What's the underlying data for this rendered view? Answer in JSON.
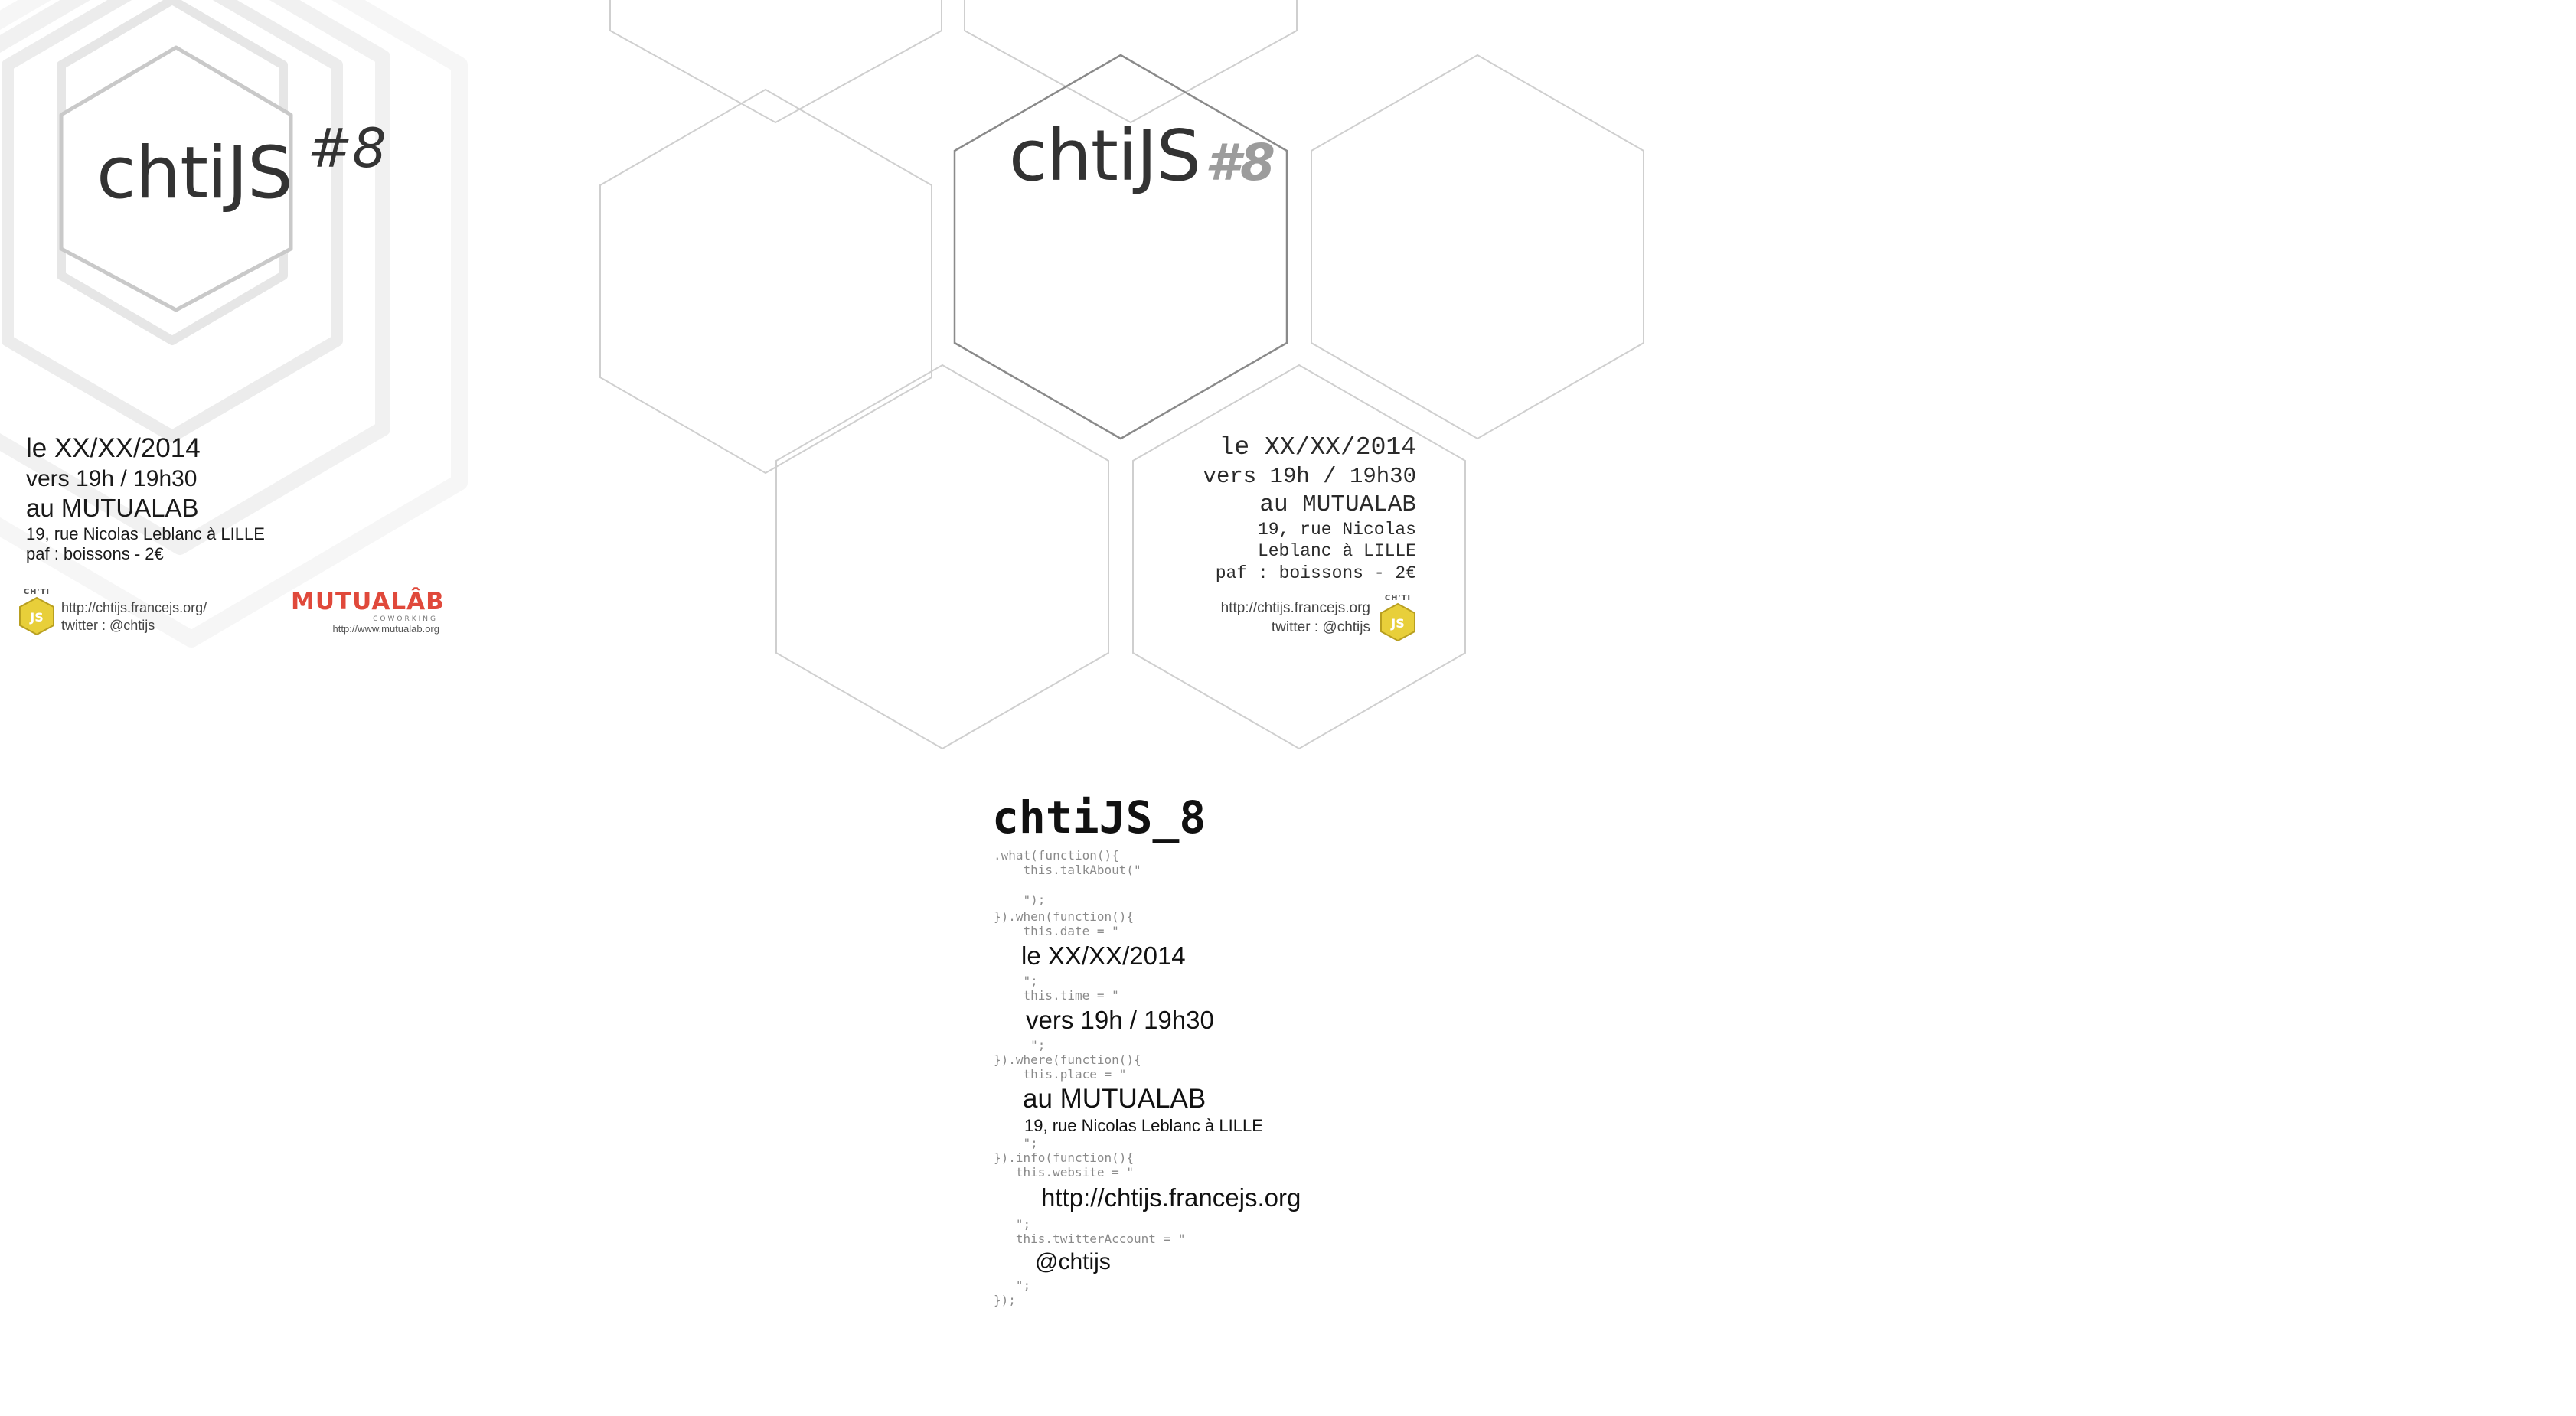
{
  "poster_left": {
    "logo_word": "chtiJS",
    "logo_number": "#8",
    "date": "le XX/XX/2014",
    "time": "vers 19h / 19h30",
    "place": "au MUTUALAB",
    "address": "19, rue Nicolas Leblanc à LILLE",
    "fee": "paf  :  boissons - 2€",
    "website": "http://chtijs.francejs.org/",
    "twitter": "twitter : @chtijs",
    "badge_caption": "CH'TI",
    "badge_text": "JS",
    "sponsor_name": "MUTUALÂB",
    "sponsor_tagline": "COWORKING",
    "sponsor_url": "http://www.mutualab.org"
  },
  "poster_hex": {
    "logo_word": "chtiJS",
    "logo_number": "#8",
    "date": "le XX/XX/2014",
    "time": "vers 19h / 19h30",
    "place": "au MUTUALAB",
    "address_line1": "19, rue Nicolas",
    "address_line2": "Leblanc à LILLE",
    "fee": "paf  :  boissons - 2€",
    "website": "http://chtijs.francejs.org",
    "twitter": "twitter : @chtijs",
    "badge_caption": "CH'TI",
    "badge_text": "JS"
  },
  "poster_code": {
    "title": "chtiJS_8",
    "code_what": ".what(function(){\n    this.talkAbout(\"\n\n    \");",
    "code_when": "}).when(function(){\n    this.date = \"",
    "date": "le XX/XX/2014",
    "code_time": "    \";\n    this.time = \"",
    "time": "vers 19h / 19h30",
    "code_where": "     \";\n}).where(function(){\n    this.place = \"",
    "place": "au MUTUALAB",
    "address": "19, rue Nicolas Leblanc à LILLE",
    "code_info": "    \";\n}).info(function(){\n   this.website = \"",
    "website": "http://chtijs.francejs.org",
    "code_twitter": "   \";\n   this.twitterAccount = \"",
    "twitter": "@chtijs",
    "code_end": "   \";\n});"
  }
}
